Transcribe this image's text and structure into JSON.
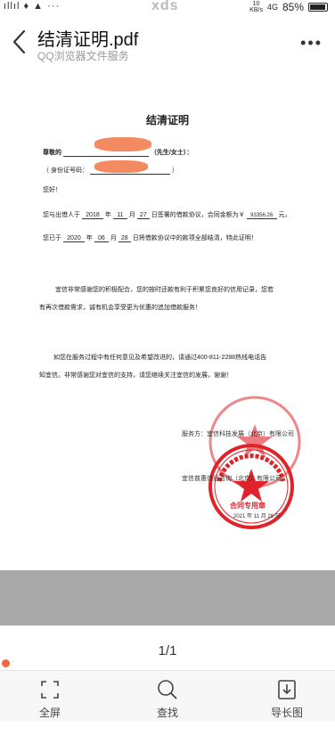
{
  "status_bar": {
    "left": "ıllıl ♦ ▲ ···",
    "center": "xds",
    "net_speed": "10",
    "net_unit": "KB/s",
    "network": "4G",
    "battery": "85%"
  },
  "header": {
    "title": "结清证明.pdf",
    "subtitle": "QQ浏览器文件服务"
  },
  "document": {
    "title": "结清证明",
    "salutation_prefix": "尊敬的",
    "salutation_suffix": "（先生/女士）：",
    "id_prefix": "（ 身份证号码：",
    "id_suffix": "）",
    "greeting": "您好！",
    "l1_a": "您与出借人于",
    "l1_year": "2018",
    "l1_b": "年",
    "l1_month": "11",
    "l1_c": "月",
    "l1_day": "27",
    "l1_d": "日签署的借款协议，合同金额为￥",
    "l1_amount": "93356.26",
    "l1_e": "元，",
    "l2_a": "您已于",
    "l2_year": "2020",
    "l2_b": "年",
    "l2_month": "06",
    "l2_c": "月",
    "l2_day": "28",
    "l2_d": "日将借款协议中的款项全部结清，特此证明！",
    "p2_line1": "宜信非常感谢您的积极配合，您的按时还款有利于积累您良好的信用记录，您若",
    "p2_line2": "有再次借款需求，诚有机会享受更为优惠的追加借款服务！",
    "p3_line1": "如您在服务过程中有任何意见及希望改进的，请通过400-811-2288热线电话告",
    "p3_line2": "知宜信。非常感谢您对宜信的支持，请您继续关注宜信的发展，谢谢！",
    "sign1": "服务方：宜信科技发展（北京）有限公司",
    "sign2": "宜信普惠信息咨询（北京）有限公司",
    "date_year": "2021",
    "date_month": "11",
    "date_day": "28",
    "date_unit1": "年",
    "date_unit2": "月",
    "date_unit3": "日",
    "stamp_text": "合同专用章"
  },
  "pager": "1/1",
  "progress": 0,
  "toolbar": {
    "fullscreen": "全屏",
    "search": "查找",
    "export": "导长图"
  },
  "colors": {
    "stamp": "#e0222a",
    "redact": "#f48a62",
    "accent": "#f0663c"
  }
}
